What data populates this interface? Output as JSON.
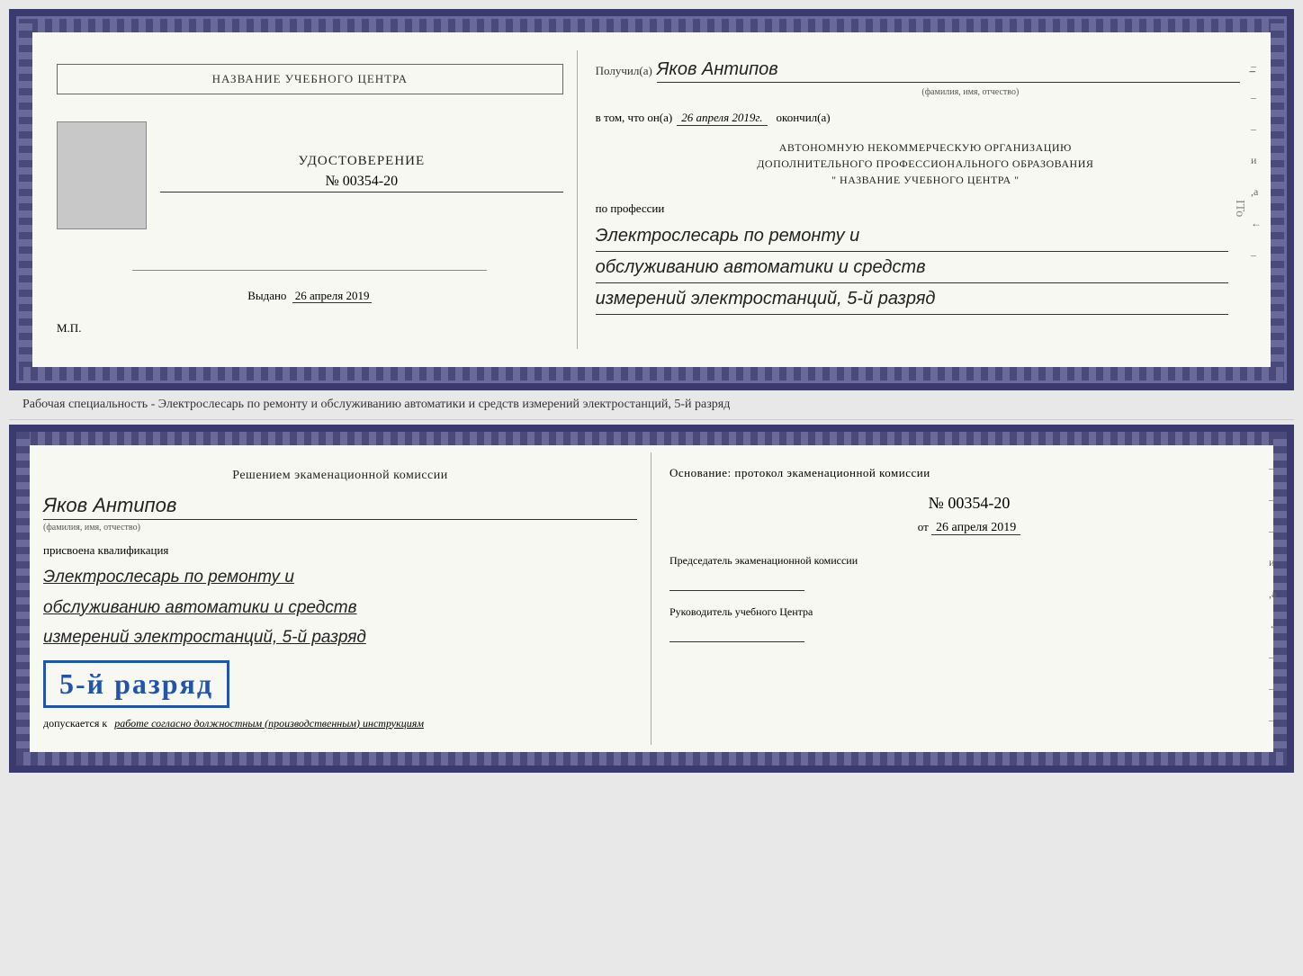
{
  "top_doc": {
    "left": {
      "school_name": "НАЗВАНИЕ УЧЕБНОГО ЦЕНТРА",
      "udostoverenie_title": "УДОСТОВЕРЕНИЕ",
      "cert_number": "№ 00354-20",
      "vydano_label": "Выдано",
      "vydano_date": "26 апреля 2019",
      "mp_label": "М.П."
    },
    "right": {
      "poluchil_label": "Получил(а)",
      "recipient_name": "Яков Антипов",
      "fio_label": "(фамилия, имя, отчество)",
      "vtom_label": "в том, что он(а)",
      "vtom_date": "26 апреля 2019г.",
      "okonchil_label": "окончил(а)",
      "org_line1": "АВТОНОМНУЮ НЕКОММЕРЧЕСКУЮ ОРГАНИЗАЦИЮ",
      "org_line2": "ДОПОЛНИТЕЛЬНОГО ПРОФЕССИОНАЛЬНОГО ОБРАЗОВАНИЯ",
      "org_line3": "\"    НАЗВАНИЕ УЧЕБНОГО ЦЕНТРА    \"",
      "po_professii_label": "по профессии",
      "profession_line1": "Электрослесарь по ремонту и",
      "profession_line2": "обслуживанию автоматики и средств",
      "profession_line3": "измерений электростанций, 5-й разряд",
      "side_marks": [
        "-",
        "-",
        "-",
        "и",
        ",а",
        "←",
        "-"
      ]
    }
  },
  "middle_text": "Рабочая специальность - Электрослесарь по ремонту и обслуживанию автоматики и средств измерений электростанций, 5-й разряд",
  "bottom_doc": {
    "left": {
      "decision_title": "Решением экаменационной комиссии",
      "person_name": "Яков Антипов",
      "fio_label": "(фамилия, имя, отчество)",
      "prisvoena_label": "присвоена квалификация",
      "qual_line1": "Электрослесарь по ремонту и",
      "qual_line2": "обслуживанию автоматики и средств",
      "qual_line3": "измерений электростанций, 5-й разряд",
      "rank_badge": "5-й разряд",
      "dopusk_label": "допускается к",
      "dopusk_text": "работе согласно должностным (производственным) инструкциям"
    },
    "right": {
      "osnovanie_title": "Основание: протокол экаменационной комиссии",
      "protocol_number": "№ 00354-20",
      "ot_label": "от",
      "ot_date": "26 апреля 2019",
      "predsedatel_title": "Председатель экаменационной комиссии",
      "rukovoditel_title": "Руководитель учебного Центра",
      "side_marks": [
        "-",
        "-",
        "-",
        "и",
        ",а",
        "←",
        "-",
        "-",
        "-"
      ]
    }
  },
  "ito_text": "ITo"
}
